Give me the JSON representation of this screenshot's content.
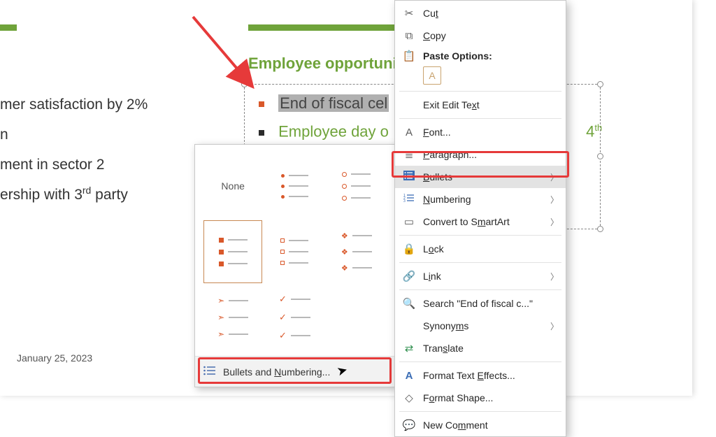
{
  "left_list": {
    "l1": "mer satisfaction by 2%",
    "l2": "n",
    "l3": "ment in sector 2",
    "l4_a": "ership with 3",
    "l4_sup": "rd",
    "l4_b": " party"
  },
  "title": "Employee opportuni",
  "list_items": {
    "i1": "End of fiscal cel",
    "i2_a": "Employee day o",
    "i2_b": "4",
    "i2_sup": "th"
  },
  "date": "January 25, 2023",
  "gallery": {
    "none": "None",
    "footer_a": "Bullets and ",
    "footer_u": "N",
    "footer_b": "umbering..."
  },
  "ctx": {
    "cut": "Cut",
    "copy": "Copy",
    "paste_header": "Paste Options:",
    "exit": "Exit Edit Text",
    "font": "Font...",
    "paragraph": "Paragraph...",
    "bullets": "Bullets",
    "numbering": "Numbering",
    "smartart": "Convert to SmartArt",
    "lock": "Lock",
    "link": "Link",
    "search": "Search \"End of fiscal c...\"",
    "synonyms": "Synonyms",
    "translate": "Translate",
    "text_effects": "Format Text Effects...",
    "shape": "Format Shape...",
    "comment": "New Comment"
  }
}
